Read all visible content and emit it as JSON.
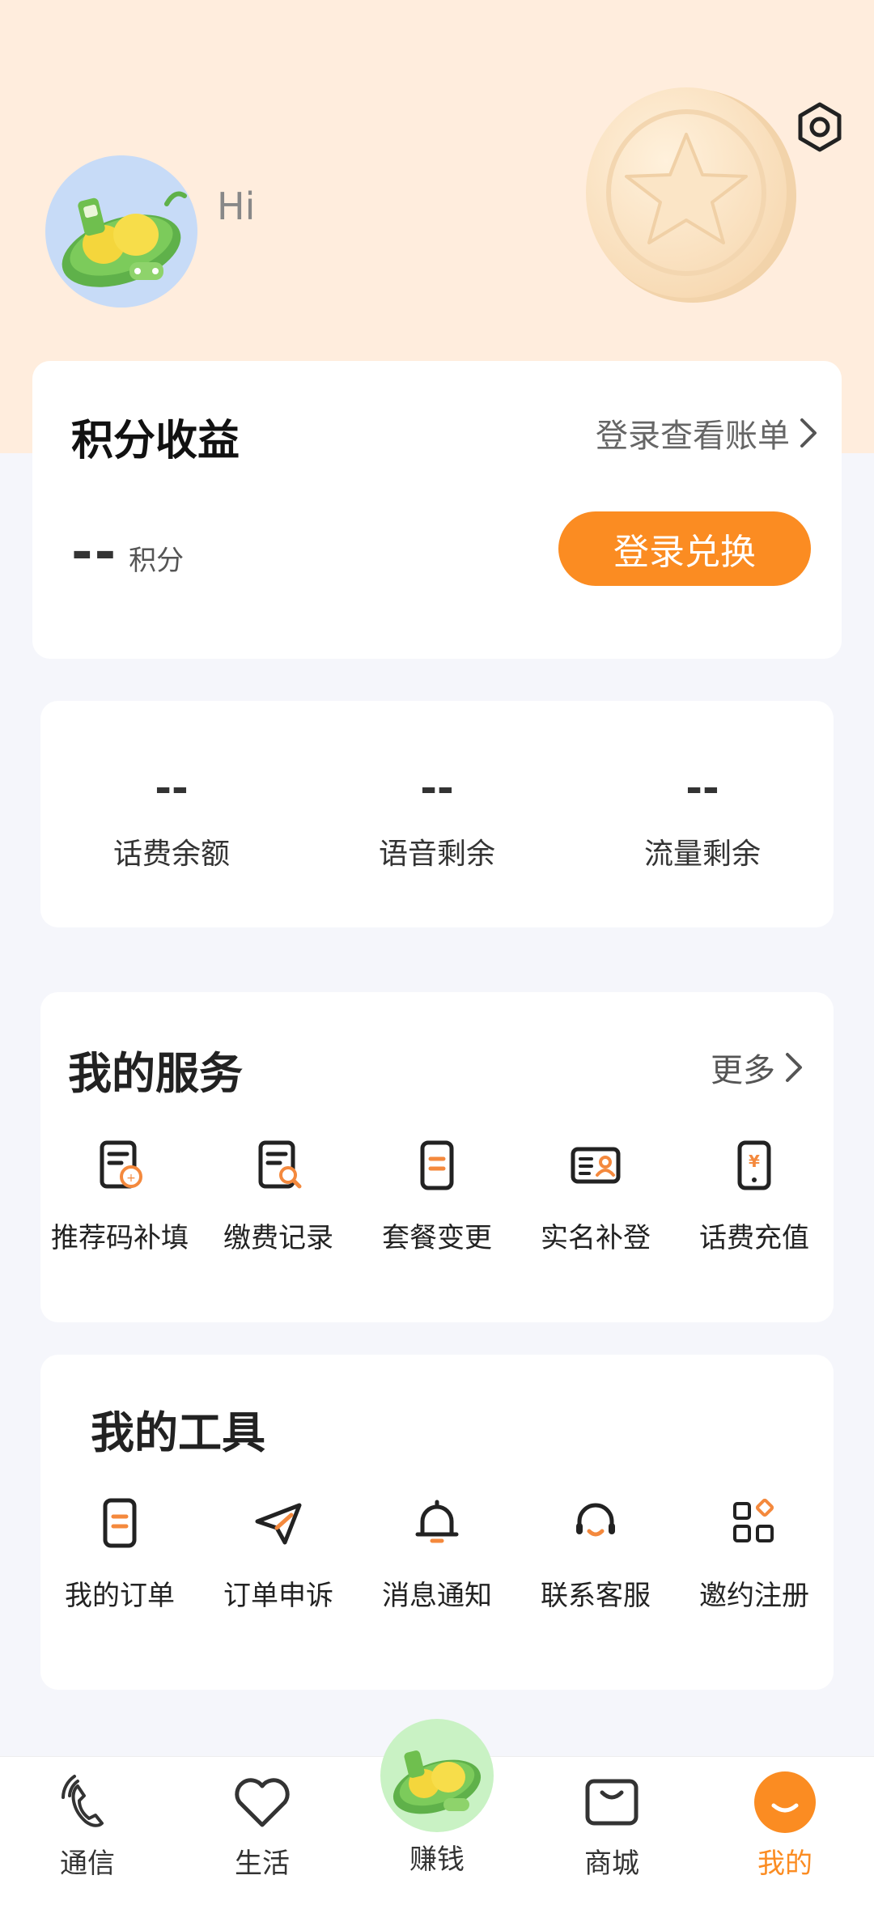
{
  "header": {
    "greeting": "Hi",
    "settings_icon": "settings-hexagon-icon",
    "decor_icon": "star-coin-icon",
    "avatar_icon": "pea-pod-mascot-icon"
  },
  "points": {
    "title": "积分收益",
    "bill_link": "登录查看账单",
    "value": "--",
    "unit": "积分",
    "redeem_button": "登录兑换"
  },
  "balance": {
    "items": [
      {
        "value": "--",
        "label": "话费余额"
      },
      {
        "value": "--",
        "label": "语音剩余"
      },
      {
        "value": "--",
        "label": "流量剩余"
      }
    ]
  },
  "services": {
    "title": "我的服务",
    "more": "更多",
    "items": [
      {
        "label": "推荐码补填",
        "icon": "referral-doc-icon"
      },
      {
        "label": "缴费记录",
        "icon": "payment-record-icon"
      },
      {
        "label": "套餐变更",
        "icon": "plan-change-icon"
      },
      {
        "label": "实名补登",
        "icon": "id-card-icon"
      },
      {
        "label": "话费充值",
        "icon": "phone-recharge-icon"
      }
    ]
  },
  "tools": {
    "title": "我的工具",
    "items": [
      {
        "label": "我的订单",
        "icon": "order-icon"
      },
      {
        "label": "订单申诉",
        "icon": "paper-plane-icon"
      },
      {
        "label": "消息通知",
        "icon": "bell-icon"
      },
      {
        "label": "联系客服",
        "icon": "headset-icon"
      },
      {
        "label": "邀约注册",
        "icon": "apps-grid-icon"
      }
    ]
  },
  "nav": {
    "items": [
      {
        "label": "通信",
        "icon": "phone-icon"
      },
      {
        "label": "生活",
        "icon": "heart-icon"
      },
      {
        "label": "赚钱",
        "icon": "pea-pod-mascot-icon"
      },
      {
        "label": "商城",
        "icon": "shopping-bag-icon"
      },
      {
        "label": "我的",
        "icon": "smile-icon"
      }
    ],
    "active": "我的"
  },
  "colors": {
    "accent": "#FB8C22",
    "hero_bg": "#FFEDDD",
    "page_bg": "#F5F6FB"
  }
}
